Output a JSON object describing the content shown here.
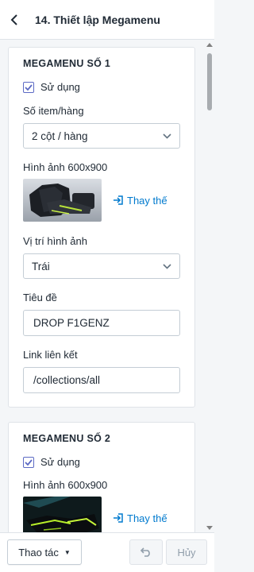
{
  "header": {
    "title": "14. Thiết lập Megamenu"
  },
  "cards": [
    {
      "title": "MEGAMENU SỐ 1",
      "enabled_label": "Sử dụng",
      "items_label": "Số item/hàng",
      "items_value": "2 cột / hàng",
      "image_label": "Hình ảnh 600x900",
      "replace_label": "Thay thế",
      "position_label": "Vị trí hình ảnh",
      "position_value": "Trái",
      "heading_label": "Tiêu đề",
      "heading_value": "DROP F1GENZ",
      "link_label": "Link liên kết",
      "link_value": "/collections/all"
    },
    {
      "title": "MEGAMENU SỐ 2",
      "enabled_label": "Sử dụng",
      "image_label": "Hình ảnh 600x900",
      "replace_label": "Thay thế"
    }
  ],
  "footer": {
    "actions_label": "Thao tác",
    "cancel_label": "Hủy"
  },
  "colors": {
    "accent": "#5c6ac4",
    "link": "#007ace",
    "disabled_text": "#919eab"
  }
}
